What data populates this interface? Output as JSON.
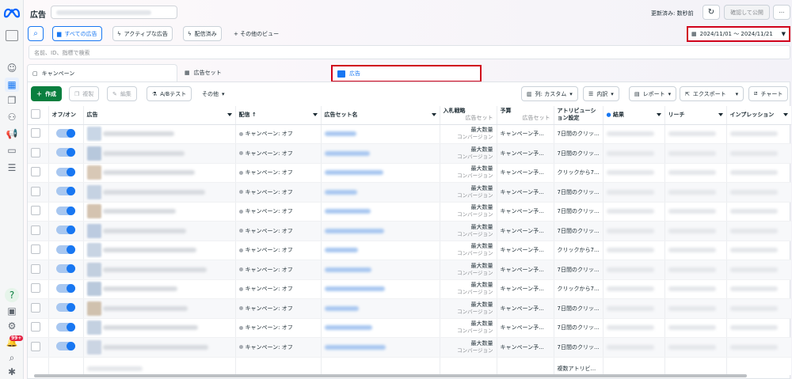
{
  "app": {
    "title": "広告",
    "updated": "更新済み: 数秒前",
    "confirm_label": "確認して公開",
    "more_label": "···"
  },
  "toolbar": {
    "all_ads": "すべての広告",
    "active_ads": "アクティブな広告",
    "delivered": "配信済み",
    "more_views": "+ その他のビュー",
    "date_range": "2024/11/01 ～ 2024/11/21"
  },
  "search": {
    "placeholder": "名前、ID、指標で検索"
  },
  "tabs": [
    {
      "label": "キャンペーン"
    },
    {
      "label": "広告セット"
    },
    {
      "label": "広告"
    }
  ],
  "actions": {
    "create": "作成",
    "duplicate": "複製",
    "edit": "編集",
    "ab_test": "A/Bテスト",
    "more": "その他",
    "columns": "列: カスタム",
    "breakdown": "内訳",
    "report": "レポート",
    "export": "エクスポート",
    "chart": "チャート"
  },
  "columns": {
    "onoff": "オフ/オン",
    "ad": "広告",
    "delivery": "配信 ↑",
    "adset": "広告セット名",
    "bid": "入札戦略",
    "bid_sub": "広告セット",
    "budget": "予算",
    "budget_sub": "広告セット",
    "attr": "アトリビューション設定",
    "result": "結果",
    "reach": "リーチ",
    "impressions": "インプレッション"
  },
  "rows": [
    {
      "delivery": "キャンペーン: オフ",
      "bid": "最大数量",
      "bid_sub": "コンバージョン",
      "budget": "キャンペーン予...",
      "attr": "7日間のクリッ..."
    },
    {
      "delivery": "キャンペーン: オフ",
      "bid": "最大数量",
      "bid_sub": "コンバージョン",
      "budget": "キャンペーン予...",
      "attr": "7日間のクリッ..."
    },
    {
      "delivery": "キャンペーン: オフ",
      "bid": "最大数量",
      "bid_sub": "コンバージョン",
      "budget": "キャンペーン予...",
      "attr": "クリックから7..."
    },
    {
      "delivery": "キャンペーン: オフ",
      "bid": "最大数量",
      "bid_sub": "コンバージョン",
      "budget": "キャンペーン予...",
      "attr": "7日間のクリッ..."
    },
    {
      "delivery": "キャンペーン: オフ",
      "bid": "最大数量",
      "bid_sub": "コンバージョン",
      "budget": "キャンペーン予...",
      "attr": "7日間のクリッ..."
    },
    {
      "delivery": "キャンペーン: オフ",
      "bid": "最大数量",
      "bid_sub": "コンバージョン",
      "budget": "キャンペーン予...",
      "attr": "7日間のクリッ..."
    },
    {
      "delivery": "キャンペーン: オフ",
      "bid": "最大数量",
      "bid_sub": "コンバージョン",
      "budget": "キャンペーン予...",
      "attr": "クリックから7..."
    },
    {
      "delivery": "キャンペーン: オフ",
      "bid": "最大数量",
      "bid_sub": "コンバージョン",
      "budget": "キャンペーン予...",
      "attr": "7日間のクリッ..."
    },
    {
      "delivery": "キャンペーン: オフ",
      "bid": "最大数量",
      "bid_sub": "コンバージョン",
      "budget": "キャンペーン予...",
      "attr": "クリックから7..."
    },
    {
      "delivery": "キャンペーン: オフ",
      "bid": "最大数量",
      "bid_sub": "コンバージョン",
      "budget": "キャンペーン予...",
      "attr": "7日間のクリッ..."
    },
    {
      "delivery": "キャンペーン: オフ",
      "bid": "最大数量",
      "bid_sub": "コンバージョン",
      "budget": "キャンペーン予...",
      "attr": "7日間のクリッ..."
    },
    {
      "delivery": "キャンペーン: オフ",
      "bid": "最大数量",
      "bid_sub": "コンバージョン",
      "budget": "キャンペーン予...",
      "attr": "7日間のクリッ..."
    }
  ],
  "summary": {
    "attr": "複数アトリビ..."
  },
  "sidebar": {
    "badge": "99+"
  },
  "colors": {
    "accent": "#1877f2",
    "create": "#0a7f3f",
    "highlight": "#d0021b"
  }
}
